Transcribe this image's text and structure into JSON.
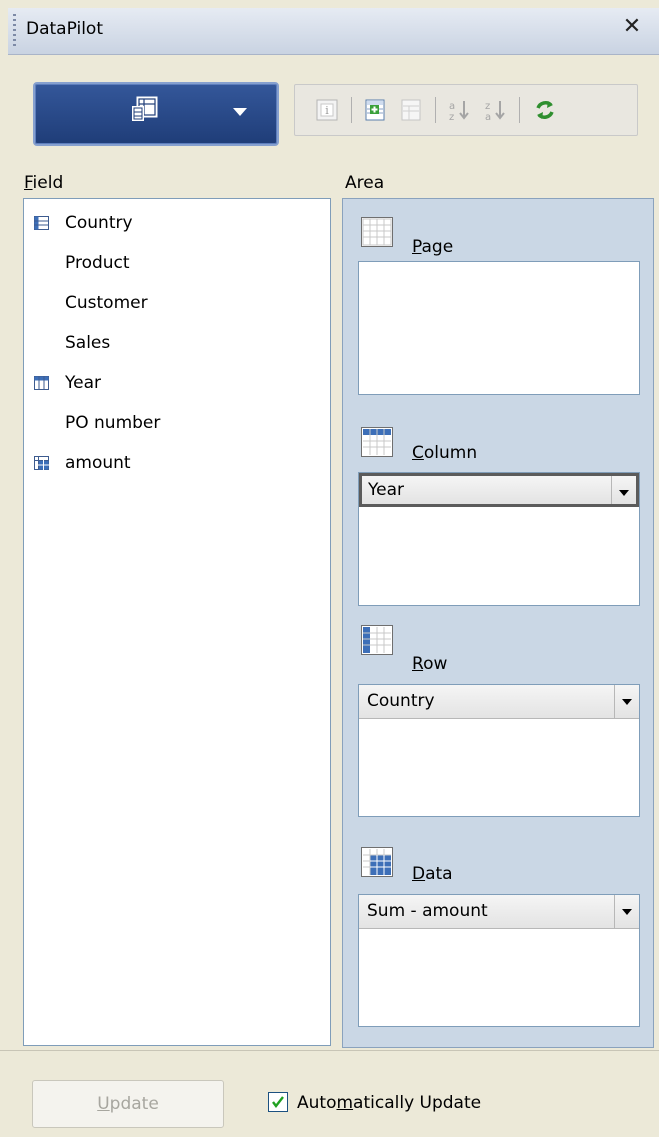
{
  "window": {
    "title": "DataPilot",
    "close_icon": "close-icon"
  },
  "mode_button": {
    "icon": "pivot-layout-icon",
    "arrow": "dropdown-arrow-icon"
  },
  "toolbar": {
    "icons": [
      "info-icon",
      "add-field-icon",
      "remove-field-icon",
      "sort-ascending-icon",
      "sort-descending-icon",
      "refresh-icon"
    ]
  },
  "field": {
    "label_prefix": "",
    "label_underlined": "F",
    "label_rest": "ield",
    "items": [
      {
        "label": "Country",
        "icon": "row-field-icon"
      },
      {
        "label": "Product",
        "icon": ""
      },
      {
        "label": "Customer",
        "icon": ""
      },
      {
        "label": "Sales",
        "icon": ""
      },
      {
        "label": "Year",
        "icon": "column-field-icon"
      },
      {
        "label": "PO number",
        "icon": ""
      },
      {
        "label": "amount",
        "icon": "data-field-icon"
      }
    ]
  },
  "area": {
    "label": "Area",
    "page": {
      "u": "P",
      "rest": "age"
    },
    "column": {
      "u": "C",
      "rest": "olumn",
      "chip": "Year"
    },
    "row": {
      "u": "R",
      "rest": "ow",
      "chip": "Country"
    },
    "data": {
      "u": "D",
      "rest": "ata",
      "chip": "Sum - amount"
    }
  },
  "bottom": {
    "update_u": "U",
    "update_rest": "pdate",
    "auto_pre": "Auto",
    "auto_u": "m",
    "auto_rest": "atically Update",
    "auto_checked": true
  },
  "colors": {
    "accent": "#1f3d78",
    "area_bg": "#cad7e5"
  }
}
